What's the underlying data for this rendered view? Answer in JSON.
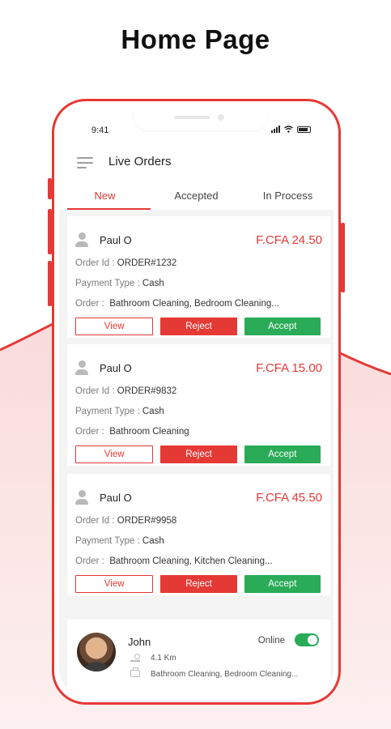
{
  "page": {
    "title": "Home Page"
  },
  "colors": {
    "accent": "#e53935",
    "success": "#2aab57",
    "screen_bg": "#f4f4f4"
  },
  "status_bar": {
    "time": "9:41",
    "icons": [
      "signal-icon",
      "wifi-icon",
      "battery-icon"
    ]
  },
  "header": {
    "menu_icon": "hamburger-icon",
    "title": "Live Orders"
  },
  "tabs": [
    {
      "label": "New",
      "active": true
    },
    {
      "label": "Accepted",
      "active": false
    },
    {
      "label": "In Process",
      "active": false
    }
  ],
  "labels": {
    "order_id": "Order Id :",
    "payment_type": "Payment Type :",
    "order": "Order :"
  },
  "orders": [
    {
      "customer": "Paul O",
      "price": "F.CFA 24.50",
      "order_id": "ORDER#1232",
      "payment_type": "Cash",
      "services": "Bathroom Cleaning, Bedroom Cleaning...",
      "buttons": {
        "view": "View",
        "reject": "Reject",
        "accept": "Accept"
      }
    },
    {
      "customer": "Paul O",
      "price": "F.CFA 15.00",
      "order_id": "ORDER#9832",
      "payment_type": "Cash",
      "services": "Bathroom Cleaning",
      "buttons": {
        "view": "View",
        "reject": "Reject",
        "accept": "Accept"
      }
    },
    {
      "customer": "Paul O",
      "price": "F.CFA 45.50",
      "order_id": "ORDER#9958",
      "payment_type": "Cash",
      "services": "Bathroom Cleaning, Kitchen Cleaning...",
      "buttons": {
        "view": "View",
        "reject": "Reject",
        "accept": "Accept"
      }
    }
  ],
  "driver": {
    "name": "John",
    "status": "Online",
    "online": true,
    "distance": "4.1 Km",
    "services": "Bathroom Cleaning, Bedroom Cleaning..."
  }
}
